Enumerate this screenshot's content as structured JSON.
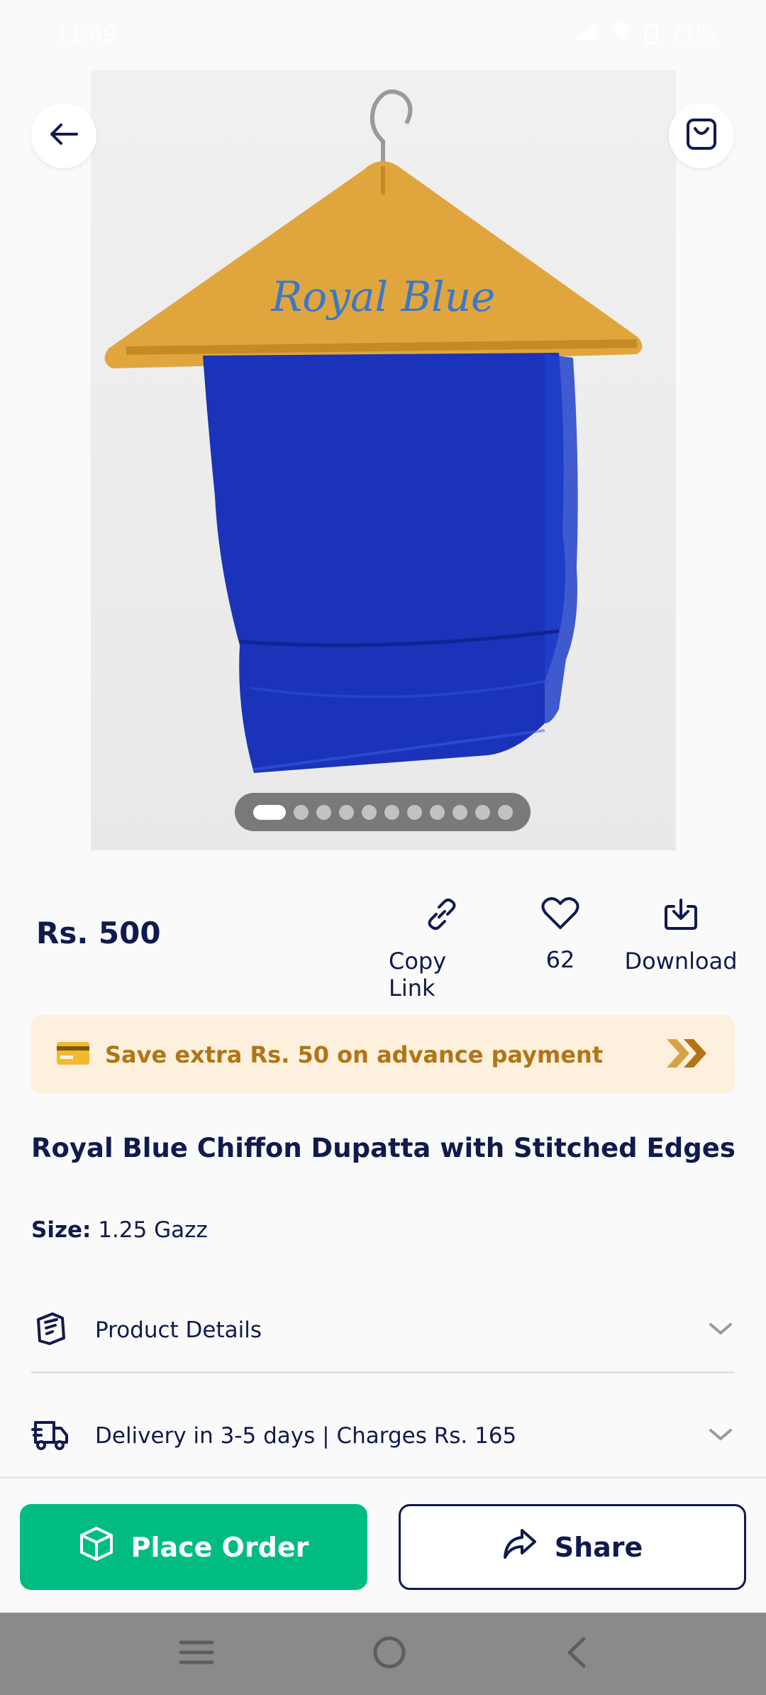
{
  "status_bar": {
    "time": "11:49",
    "battery": "71%"
  },
  "gallery": {
    "image_caption": "Royal Blue",
    "total_images": 11,
    "active_index": 0
  },
  "price": "Rs. 500",
  "actions": {
    "copy_link": "Copy Link",
    "likes": "62",
    "download": "Download"
  },
  "promo": {
    "text": "Save extra Rs. 50 on advance payment"
  },
  "product": {
    "title": "Royal Blue Chiffon Dupatta with Stitched Edges",
    "size_label": "Size:",
    "size_value": "1.25 Gazz"
  },
  "accordions": {
    "details_label": "Product Details",
    "delivery_label": "Delivery in 3-5 days | Charges Rs. 165"
  },
  "buttons": {
    "place_order": "Place Order",
    "share": "Share"
  },
  "colors": {
    "primary_navy": "#101a4d",
    "order_green": "#00bc82",
    "promo_bg": "#fdf0dc",
    "promo_text": "#b27416",
    "fabric_blue": "#1a33b8"
  },
  "icons": {
    "back": "arrow-left-icon",
    "cart": "shopping-bag-icon",
    "copy": "link-icon",
    "like": "heart-icon",
    "download": "download-icon",
    "card": "credit-card-icon",
    "chevrons": "double-chevron-right-icon",
    "details": "document-icon",
    "delivery": "truck-icon",
    "expand": "chevron-down-icon",
    "box": "box-icon",
    "share": "share-arrow-icon"
  }
}
